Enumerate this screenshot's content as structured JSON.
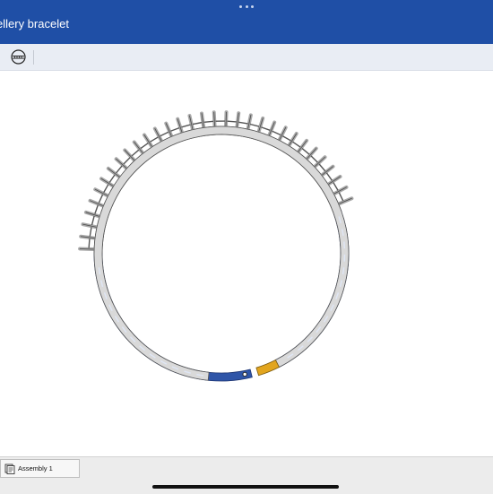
{
  "window": {
    "title": "ellery bracelet",
    "more_icon": "ellipsis-icon"
  },
  "toolbar": {
    "tools": [
      {
        "icon": "wrap-icon"
      }
    ]
  },
  "viewport": {
    "model_name": "bracelet-model",
    "colors": {
      "selected_band": "#2f55a8",
      "link_chain": "#a9a9a9",
      "clasp": "#d9d9d9",
      "accent_segment": "#e2a51e"
    }
  },
  "tabs": [
    {
      "label": "Assembly 1",
      "icon": "assembly-icon",
      "active": true
    }
  ]
}
